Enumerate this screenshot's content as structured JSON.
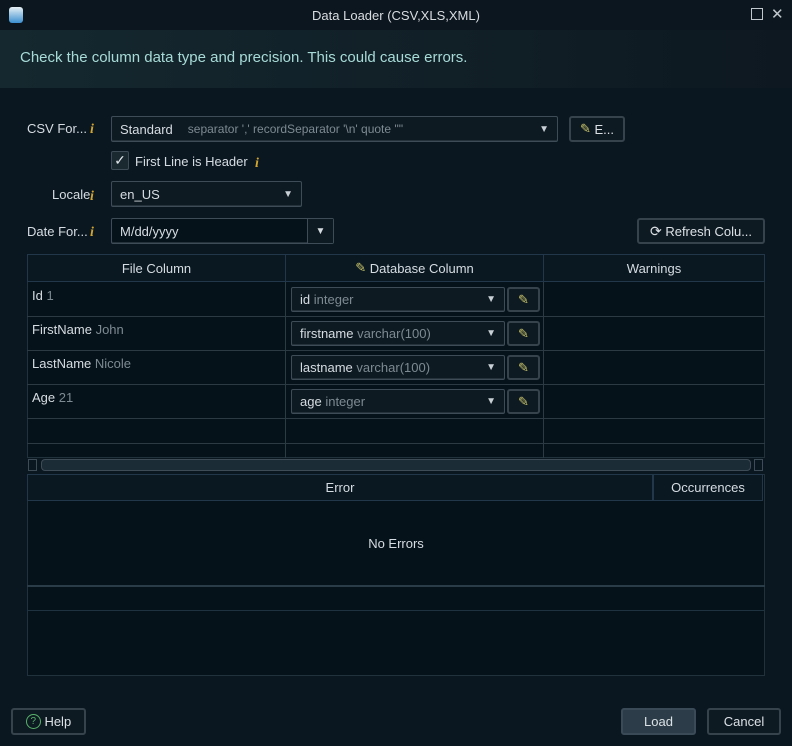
{
  "window": {
    "title": "Data Loader (CSV,XLS,XML)"
  },
  "banner": {
    "message": "Check the column data type and precision. This could cause errors."
  },
  "form": {
    "csv_format": {
      "label": "CSV For...",
      "value": "Standard",
      "detail": "separator ',' recordSeparator '\\n'  quote '\"'",
      "edit_label": "E..."
    },
    "first_line_header": {
      "label": "First Line is Header",
      "checked": true
    },
    "locale": {
      "label": "Locale",
      "value": "en_US"
    },
    "date_format": {
      "label": "Date For...",
      "value": "M/dd/yyyy"
    },
    "refresh_label": "Refresh Colu...",
    "info_glyph": "i"
  },
  "mapping": {
    "headers": [
      "File Column",
      "Database Column",
      "Warnings"
    ],
    "rows": [
      {
        "file_name": "Id",
        "file_sample": "1",
        "db_name": "id",
        "db_type": "integer",
        "warning": ""
      },
      {
        "file_name": "FirstName",
        "file_sample": "John",
        "db_name": "firstname",
        "db_type": "varchar(100)",
        "warning": ""
      },
      {
        "file_name": "LastName",
        "file_sample": "Nicole",
        "db_name": "lastname",
        "db_type": "varchar(100)",
        "warning": ""
      },
      {
        "file_name": "Age",
        "file_sample": "21",
        "db_name": "age",
        "db_type": "integer",
        "warning": ""
      }
    ]
  },
  "errors": {
    "headers": [
      "Error",
      "Occurrences"
    ],
    "empty_message": "No Errors"
  },
  "footer": {
    "help": "Help",
    "load": "Load",
    "cancel": "Cancel"
  }
}
